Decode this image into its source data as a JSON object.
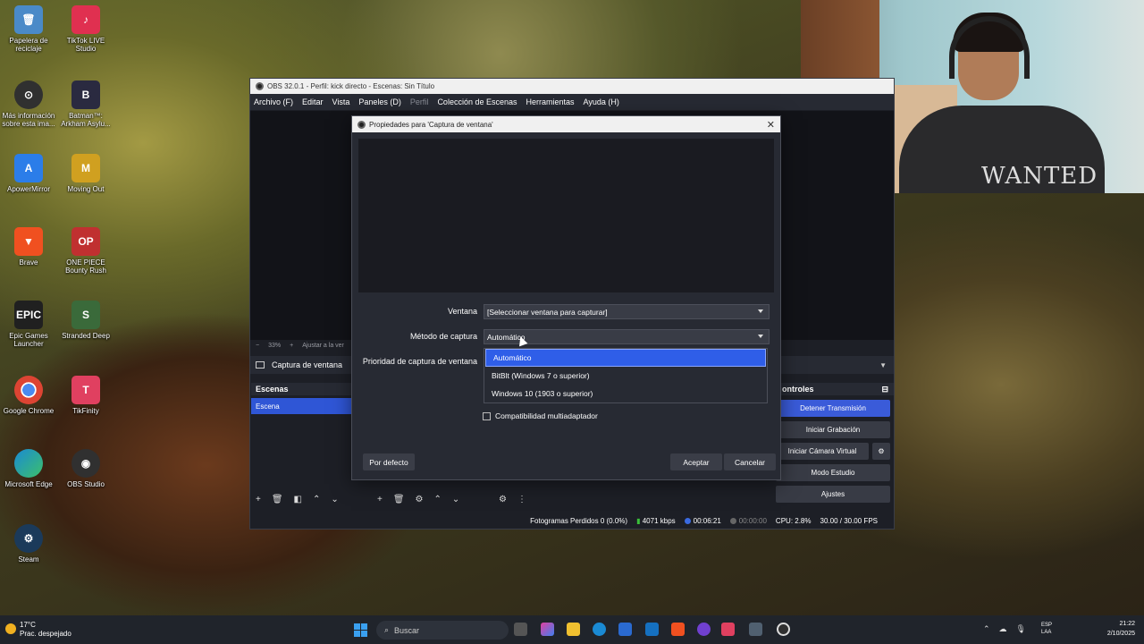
{
  "desktop": {
    "icons": [
      {
        "label": "Papelera de reciclaje",
        "color": "#4a8ac8"
      },
      {
        "label": "TikTok LIVE Studio",
        "color": "#e03050"
      },
      {
        "label": "Más información sobre esta ima...",
        "color": "#303030"
      },
      {
        "label": "Batman™: Arkham Asylu...",
        "color": "#2a2a40"
      },
      {
        "label": "ApowerMirror",
        "color": "#2b7de9"
      },
      {
        "label": "Moving Out",
        "color": "#d0a020"
      },
      {
        "label": "Brave",
        "color": "#f05020"
      },
      {
        "label": "ONE PIECE Bounty Rush",
        "color": "#c03030"
      },
      {
        "label": "Epic Games Launcher",
        "color": "#202020"
      },
      {
        "label": "Stranded Deep",
        "color": "#3a6a3a"
      },
      {
        "label": "Google Chrome",
        "color": "#dd4433"
      },
      {
        "label": "TikFinity",
        "color": "#e04060"
      },
      {
        "label": "Microsoft Edge",
        "color": "#1a8ad4"
      },
      {
        "label": "OBS Studio",
        "color": "#303030"
      },
      {
        "label": "Steam",
        "color": "#1b3a5a"
      }
    ]
  },
  "webcam": {
    "shirt_text": "WANTED"
  },
  "obs": {
    "title": "OBS 32.0.1 - Perfil: kick directo - Escenas: Sin Título",
    "menu": [
      "Archivo (F)",
      "Editar",
      "Vista",
      "Paneles (D)",
      "Perfil",
      "Colección de Escenas",
      "Herramientas",
      "Ayuda (H)"
    ],
    "preview_toolbar": {
      "minus": "−",
      "zoom": "33%",
      "plus": "+",
      "fit": "Ajustar a la ver"
    },
    "source_bar_label": "Captura de ventana",
    "scenes_title": "Escenas",
    "scene_item": "Escena",
    "controls_title": "ontroles",
    "controls": [
      "Detener Transmisión",
      "Iniciar Grabación",
      "Iniciar Cámara Virtual",
      "Modo Estudio",
      "Ajustes"
    ],
    "status": {
      "dropped": "Fotogramas Perdidos 0 (0.0%)",
      "bitrate": "4071 kbps",
      "live_time": "00:06:21",
      "rec_time": "00:00:00",
      "cpu": "CPU: 2.8%",
      "fps": "30.00 / 30.00 FPS"
    }
  },
  "dialog": {
    "title": "Propiedades para 'Captura de ventana'",
    "window_label": "Ventana",
    "window_value": "[Seleccionar ventana para capturar]",
    "method_label": "Método de captura",
    "method_value": "Automático",
    "priority_label": "Prioridad de captura de ventana",
    "method_options": [
      "Automático",
      "BitBlt (Windows 7 o superior)",
      "Windows 10 (1903 o superior)"
    ],
    "selected_option_index": 0,
    "multiadapter_label": "Compatibilidad multiadaptador",
    "multiadapter_checked": false,
    "defaults_button": "Por defecto",
    "accept_button": "Aceptar",
    "cancel_button": "Cancelar"
  },
  "taskbar": {
    "weather_temp": "17°C",
    "weather_desc": "Prac. despejado",
    "search_placeholder": "Buscar",
    "lang_top": "ESP",
    "lang_bottom": "LAA",
    "time": "21:22",
    "date": "2/10/2025"
  }
}
